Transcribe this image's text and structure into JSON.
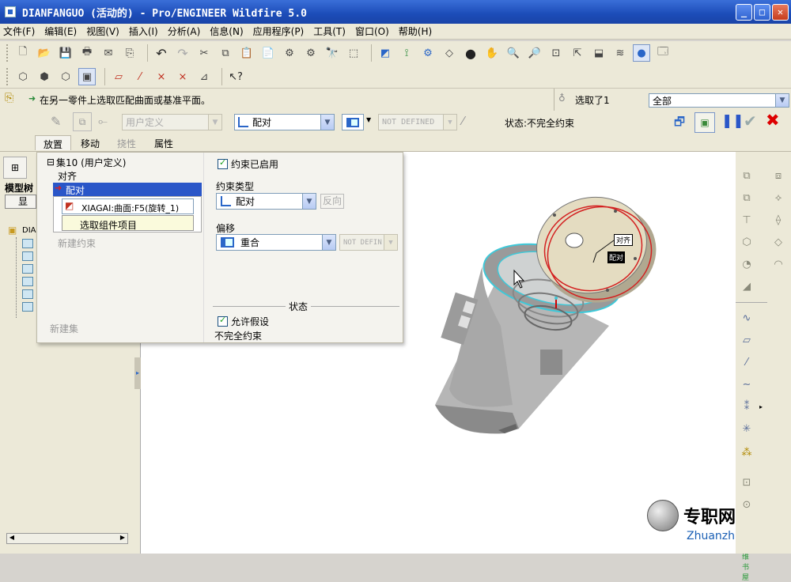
{
  "window": {
    "title": "DIANFANGUO (活动的) - Pro/ENGINEER Wildfire 5.0",
    "controls": {
      "minimize": "_",
      "maximize": "□",
      "close": "✕"
    }
  },
  "menu": [
    "文件(F)",
    "编辑(E)",
    "视图(V)",
    "插入(I)",
    "分析(A)",
    "信息(N)",
    "应用程序(P)",
    "工具(T)",
    "窗口(O)",
    "帮助(H)"
  ],
  "message_bar": {
    "prompt": "在另一零件上选取匹配曲面或基准平面。",
    "selected": "选取了1",
    "filter": "全部"
  },
  "dashboard": {
    "constraint_set": "用户定义",
    "constraint_type": "配对",
    "offset": "NOT DEFINED",
    "status": "状态:不完全约束",
    "tabs": [
      "放置",
      "移动",
      "挠性",
      "属性"
    ]
  },
  "placement_panel": {
    "set_label": "集10 (用户定义)",
    "items": [
      "对齐",
      "配对"
    ],
    "reference_1": "XIAGAI:曲面:F5(旋转_1)",
    "reference_2": "选取组件项目",
    "new_constraint": "新建约束",
    "new_set": "新建集",
    "constraint_enabled": "约束已启用",
    "constraint_type_label": "约束类型",
    "constraint_type_value": "配对",
    "flip_button": "反向",
    "offset_label": "偏移",
    "offset_value": "重合",
    "offset_field": "NOT DEFIN",
    "status_header": "状态",
    "allow_assumptions": "允许假设",
    "status_value": "不完全约束"
  },
  "left_panel": {
    "tab_label": "模型树",
    "show_button": "显示",
    "root": "DIA"
  },
  "viewport": {
    "tag_top": "对齐",
    "tag_bottom": "配对"
  },
  "watermark": {
    "brand": "专职网",
    "url": "Zhuanzhi.Net",
    "sub": "三维书屋"
  },
  "colors": {
    "titlebar": "#1c4cb8",
    "accent": "#2a66c8",
    "constraint_red": "#d00000",
    "selection_cyan": "#3fc8d8"
  }
}
